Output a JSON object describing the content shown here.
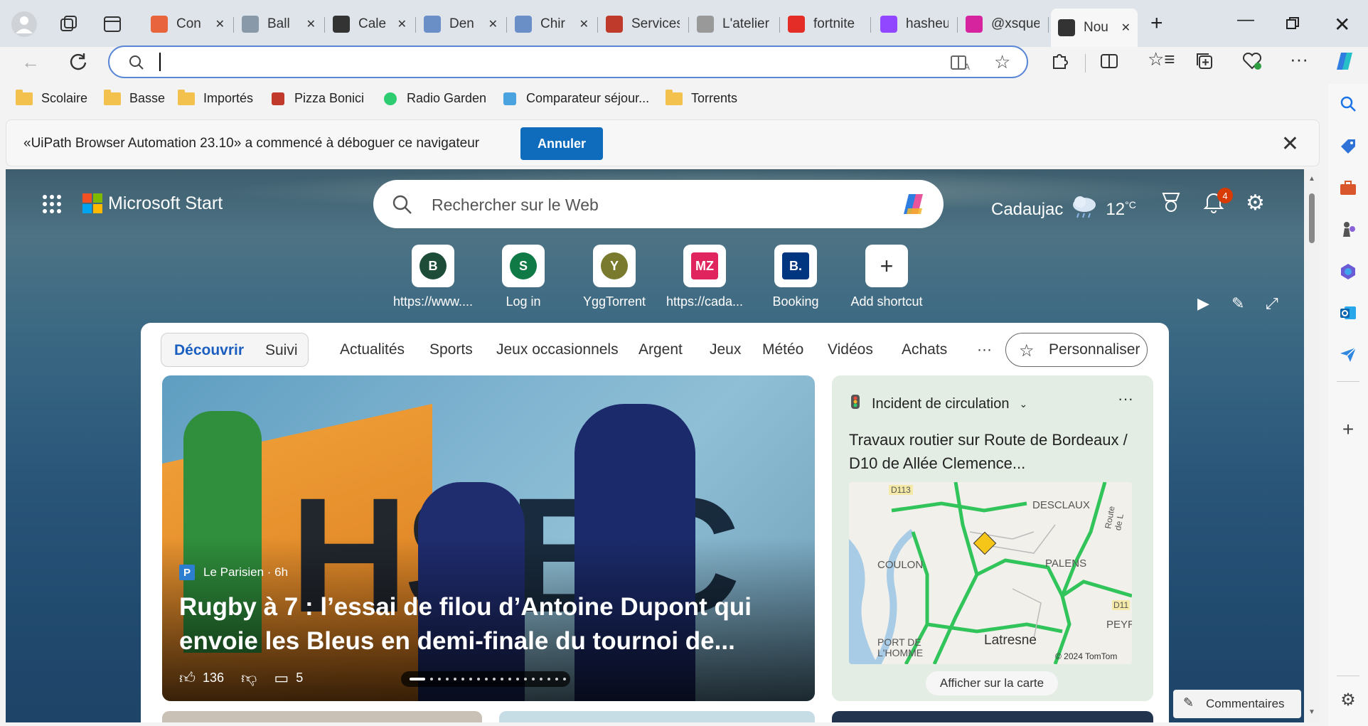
{
  "tabs": [
    {
      "label": "Con",
      "icon": "uipath-icon",
      "color": "#e8643c"
    },
    {
      "label": "Ball",
      "icon": "cloud-icon",
      "color": "#8899aa"
    },
    {
      "label": "Cale",
      "icon": "openai-icon",
      "color": "#333333"
    },
    {
      "label": "Den",
      "icon": "d-icon",
      "color": "#6a8fc7"
    },
    {
      "label": "Chir",
      "icon": "d-icon",
      "color": "#6a8fc7"
    },
    {
      "label": "Services",
      "icon": "services-icon",
      "color": "#c03a2b"
    },
    {
      "label": "L'atelier",
      "icon": "page-icon",
      "color": "#999999"
    },
    {
      "label": "fortnite",
      "icon": "youtube-icon",
      "color": "#e52d27"
    },
    {
      "label": "hasheur",
      "icon": "twitch-icon",
      "color": "#9146ff"
    },
    {
      "label": "@xsquee",
      "icon": "instagram-icon",
      "color": "#d6249f"
    },
    {
      "label": "Nou",
      "icon": "newtab-icon",
      "color": "#333333"
    }
  ],
  "bookmarks": [
    {
      "label": "Scolaire",
      "type": "folder"
    },
    {
      "label": "Basse",
      "type": "folder"
    },
    {
      "label": "Importés",
      "type": "folder"
    },
    {
      "label": "Pizza Bonici",
      "type": "link"
    },
    {
      "label": "Radio Garden",
      "type": "link"
    },
    {
      "label": "Comparateur séjour...",
      "type": "link"
    },
    {
      "label": "Torrents",
      "type": "folder"
    }
  ],
  "infobar": {
    "message": "«UiPath Browser Automation 23.10» a commencé à déboguer ce navigateur",
    "button": "Annuler"
  },
  "header": {
    "brand": "Microsoft Start",
    "search_placeholder": "Rechercher sur le Web",
    "city": "Cadaujac",
    "temperature": "12",
    "temp_unit": "°C",
    "notifications": "4"
  },
  "shortcuts": [
    {
      "label": "https://www....",
      "glyph": "B",
      "color": "#1d4d38"
    },
    {
      "label": "Log in",
      "glyph": "S",
      "color": "#0f7a45"
    },
    {
      "label": "YggTorrent",
      "glyph": "Y",
      "color": "#7a7a2e"
    },
    {
      "label": "https://cada...",
      "glyph": "MZ",
      "color": "#e0245e"
    },
    {
      "label": "Booking",
      "glyph": "B.",
      "color": "#003580"
    },
    {
      "label": "Add shortcut",
      "glyph": "+",
      "color": "#ffffff"
    }
  ],
  "feed": {
    "segment_active": "Découvrir",
    "segment_other": "Suivi",
    "categories": [
      "Actualités",
      "Sports",
      "Jeux occasionnels",
      "Argent",
      "Jeux",
      "Météo",
      "Vidéos",
      "Achats",
      "···"
    ],
    "personalize": "Personnaliser"
  },
  "hero": {
    "source": "Le Parisien",
    "age": "· 6h",
    "headline": "Rugby à 7 : l’essai de filou d’Antoine Dupont qui envoie les Bleus en demi-finale du tournoi de...",
    "likes": "136",
    "comments": "5",
    "image_text": "HSBC"
  },
  "traffic": {
    "header": "Incident de circulation",
    "title": "Travaux routier sur Route de Bordeaux / D10 de Allée Clemence...",
    "map_link": "Afficher sur la carte",
    "map_labels": [
      "D113",
      "DESCLAUX",
      "COULON",
      "PALENS",
      "PORT DE L'HOMME",
      "Latresne",
      "PEYRE",
      "D11",
      "Route de L",
      "© 2024 TomTom"
    ]
  },
  "feedback": "Commentaires"
}
